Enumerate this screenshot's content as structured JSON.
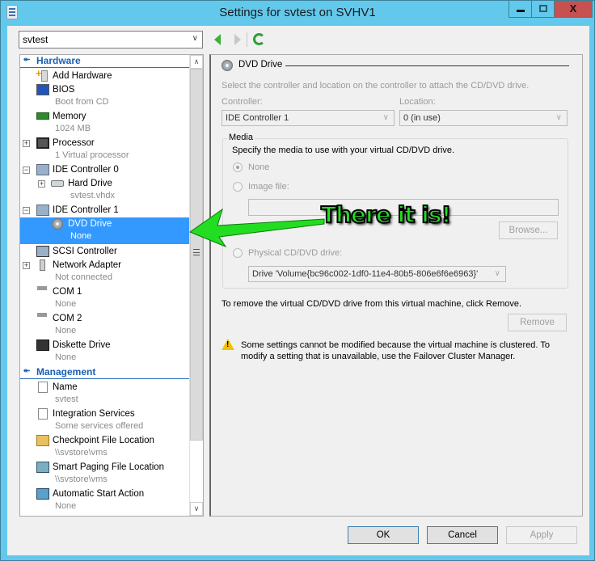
{
  "window": {
    "title": "Settings for svtest on SVHV1",
    "controls": {
      "minimize": "minimize",
      "maximize": "maximize",
      "close": "X"
    }
  },
  "toolbar": {
    "vm_selector": "svtest",
    "back_icon": "back-arrow-icon",
    "forward_icon": "forward-arrow-icon",
    "refresh_icon": "refresh-icon"
  },
  "tree": {
    "hardware_header": "Hardware",
    "management_header": "Management",
    "items": [
      {
        "label": "Add Hardware",
        "sub": ""
      },
      {
        "label": "BIOS",
        "sub": "Boot from CD"
      },
      {
        "label": "Memory",
        "sub": "1024 MB"
      },
      {
        "label": "Processor",
        "sub": "1 Virtual processor"
      },
      {
        "label": "IDE Controller 0",
        "sub": ""
      },
      {
        "label": "Hard Drive",
        "sub": "svtest.vhdx"
      },
      {
        "label": "IDE Controller 1",
        "sub": ""
      },
      {
        "label": "DVD Drive",
        "sub": "None"
      },
      {
        "label": "SCSI Controller",
        "sub": ""
      },
      {
        "label": "Network Adapter",
        "sub": "Not connected"
      },
      {
        "label": "COM 1",
        "sub": "None"
      },
      {
        "label": "COM 2",
        "sub": "None"
      },
      {
        "label": "Diskette Drive",
        "sub": "None"
      },
      {
        "label": "Name",
        "sub": "svtest"
      },
      {
        "label": "Integration Services",
        "sub": "Some services offered"
      },
      {
        "label": "Checkpoint File Location",
        "sub": "\\\\svstore\\vms"
      },
      {
        "label": "Smart Paging File Location",
        "sub": "\\\\svstore\\vms"
      },
      {
        "label": "Automatic Start Action",
        "sub": "None"
      }
    ],
    "selected": "DVD Drive"
  },
  "dvd": {
    "group_title": "DVD Drive",
    "instructions": "Select the controller and location on the controller to attach the CD/DVD drive.",
    "controller_label": "Controller:",
    "controller_value": "IDE Controller 1",
    "location_label": "Location:",
    "location_value": "0 (in use)",
    "media_label": "Media",
    "media_instructions": "Specify the media to use with your virtual CD/DVD drive.",
    "opt_none": "None",
    "opt_image": "Image file:",
    "image_path": "",
    "browse": "Browse...",
    "opt_physical": "Physical CD/DVD drive:",
    "physical_value": "Drive 'Volume{bc96c002-1df0-11e4-80b5-806e6f6e6963}'",
    "selected_media": "None",
    "remove_text": "To remove the virtual CD/DVD drive from this virtual machine, click Remove.",
    "remove": "Remove",
    "warning": "Some settings cannot be modified because the virtual machine is clustered. To modify a setting that is unavailable, use the Failover Cluster Manager."
  },
  "annotation": {
    "text": "There it is!",
    "color": "#22dd22"
  },
  "footer": {
    "ok": "OK",
    "cancel": "Cancel",
    "apply": "Apply"
  },
  "colors": {
    "titlebar": "#63c9ec",
    "selection": "#3399ff",
    "section_header": "#1a5fb4",
    "close": "#c75050"
  }
}
